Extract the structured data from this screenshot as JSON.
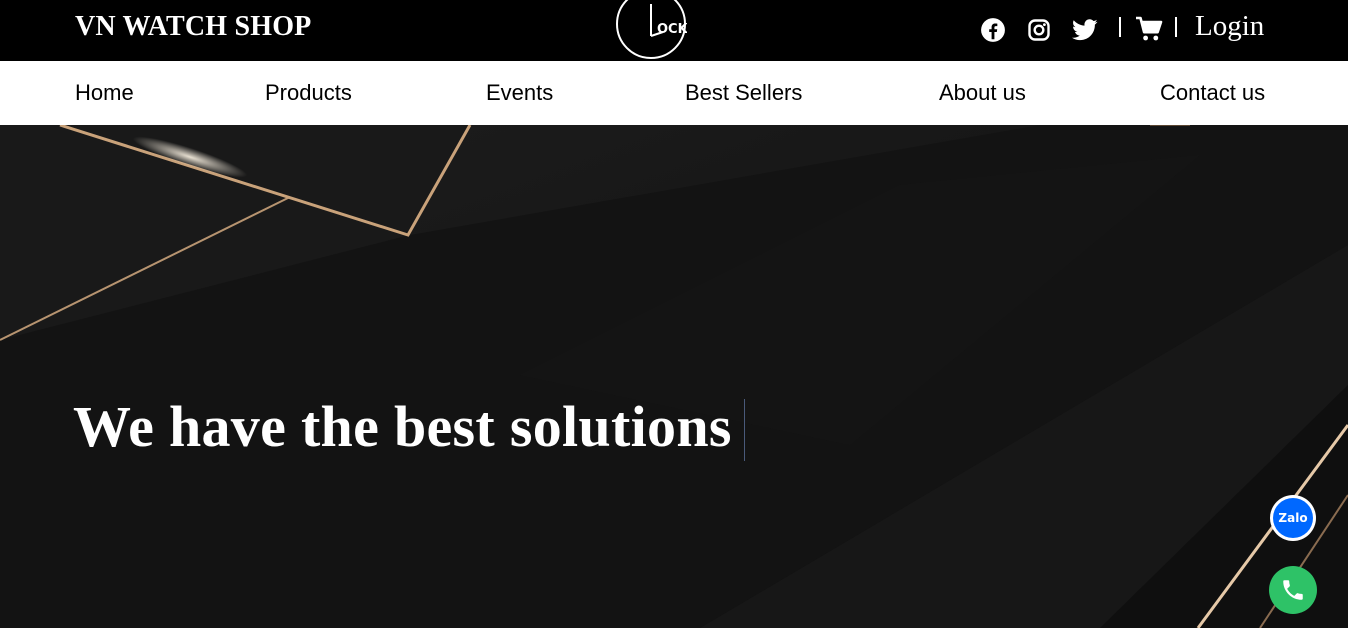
{
  "header": {
    "brand": "VN WATCH SHOP",
    "logo_text": "OCK",
    "socials": [
      "facebook-icon",
      "instagram-icon",
      "twitter-icon"
    ],
    "cart_icon": "cart-icon",
    "login_label": "Login"
  },
  "nav": {
    "items": [
      "Home",
      "Products",
      "Events",
      "Best Sellers",
      "About us",
      "Contact us"
    ]
  },
  "hero": {
    "headline": "We have the best solutions"
  },
  "floating": {
    "zalo_label": "Zalo",
    "call_icon": "phone-icon"
  },
  "colors": {
    "header_bg": "#000000",
    "nav_bg": "#ffffff",
    "hero_bg": "#141414",
    "accent_gold": "#c9a27a",
    "zalo_blue": "#0068ff",
    "call_green": "#2ec267"
  }
}
